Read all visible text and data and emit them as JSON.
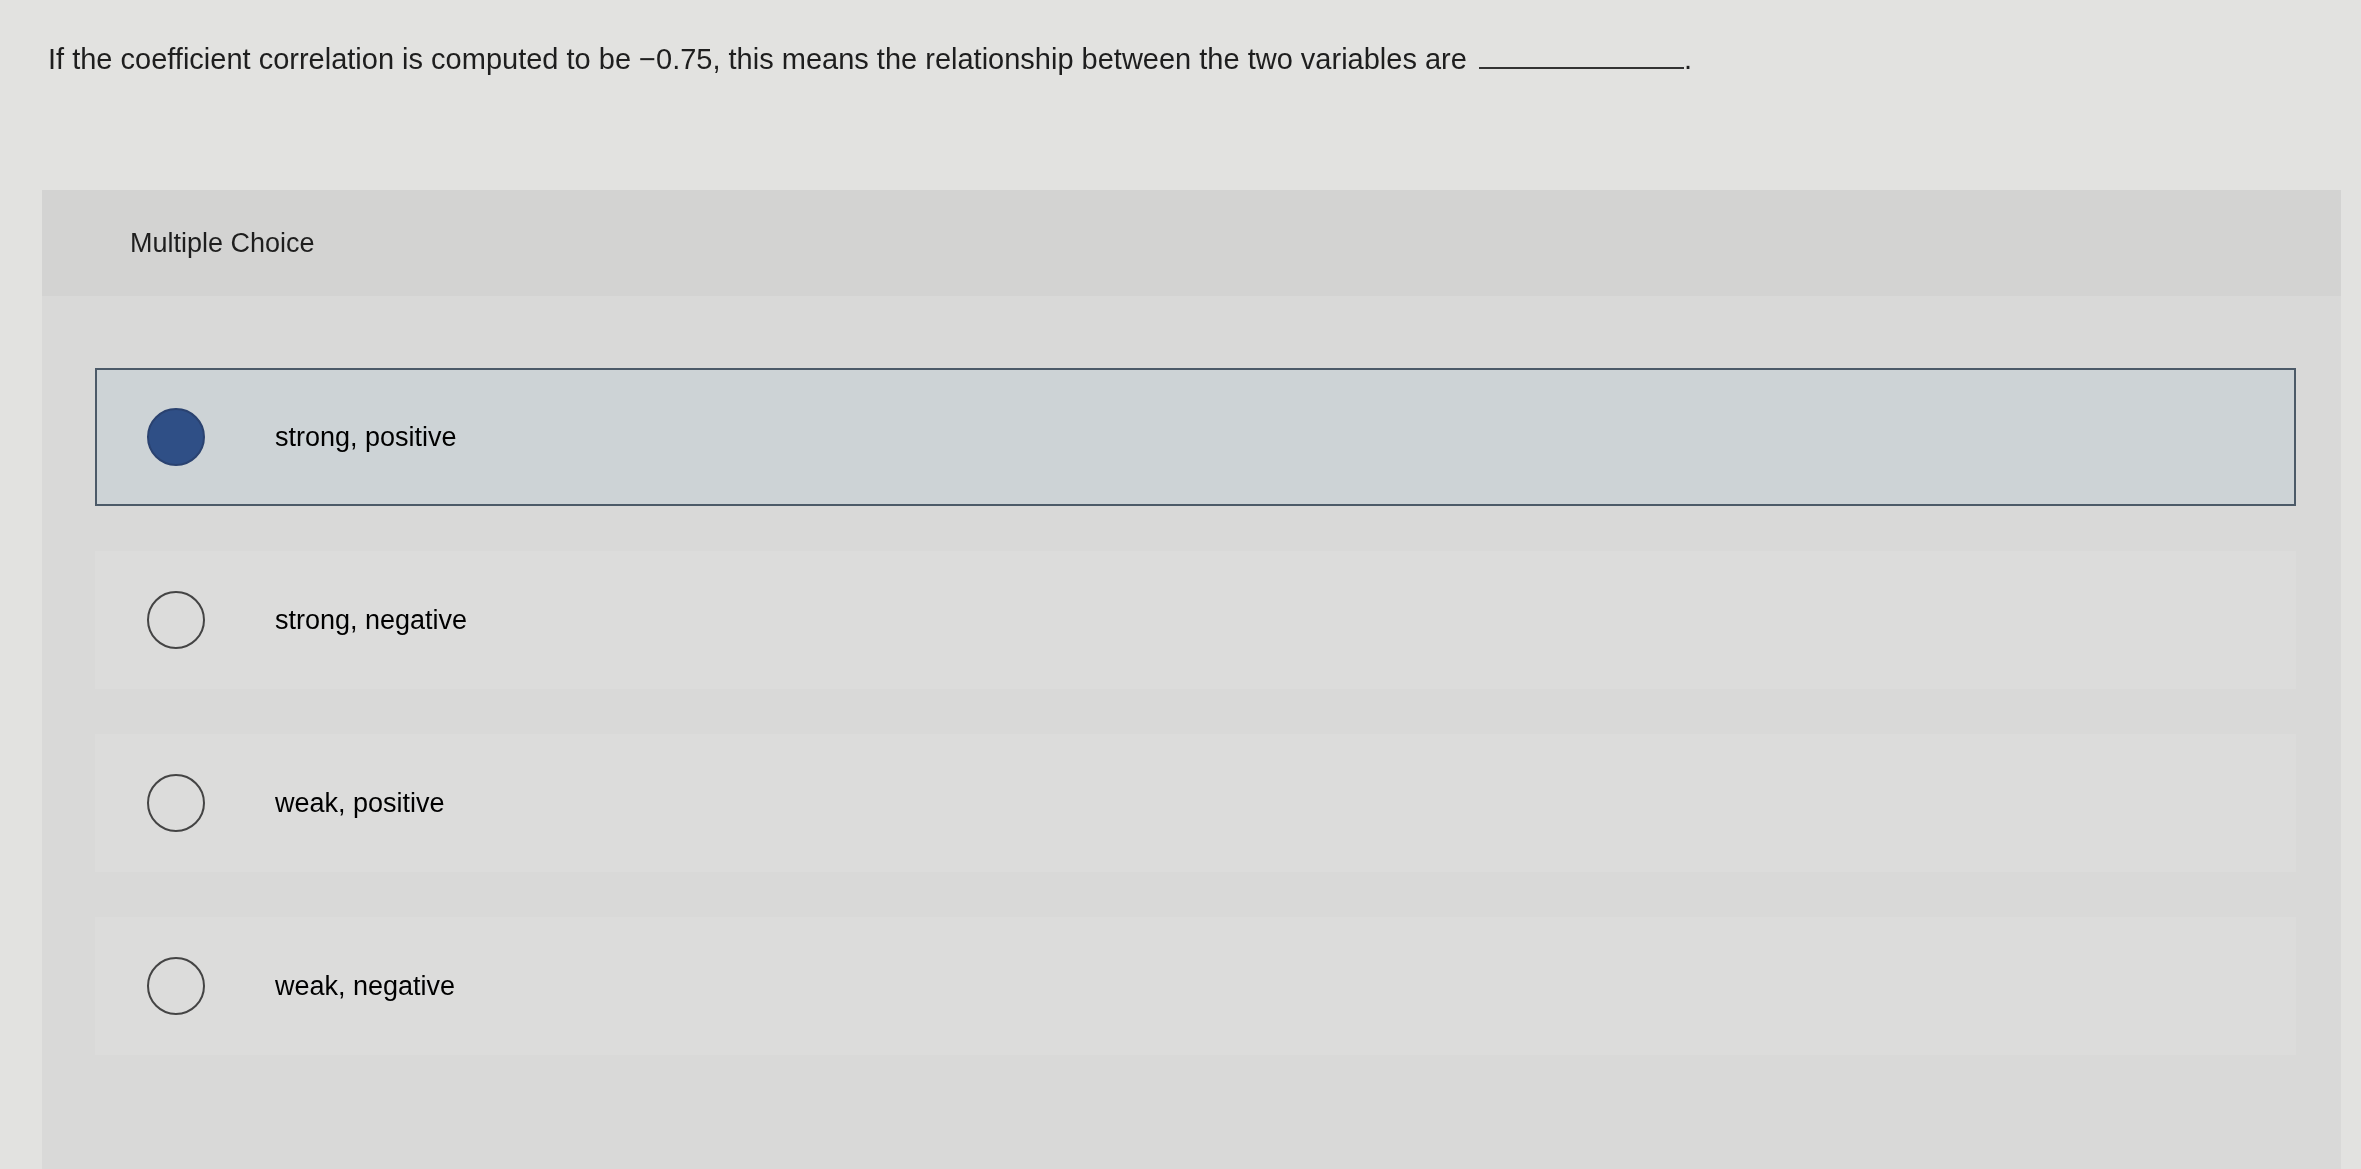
{
  "question": {
    "text": "If the coefficient correlation is computed to be −0.75, this means the relationship between the two variables are",
    "after_blank": "."
  },
  "question_type": "Multiple Choice",
  "options": [
    {
      "label": "strong, positive",
      "selected": true
    },
    {
      "label": "strong, negative",
      "selected": false
    },
    {
      "label": "weak, positive",
      "selected": false
    },
    {
      "label": "weak, negative",
      "selected": false
    }
  ]
}
